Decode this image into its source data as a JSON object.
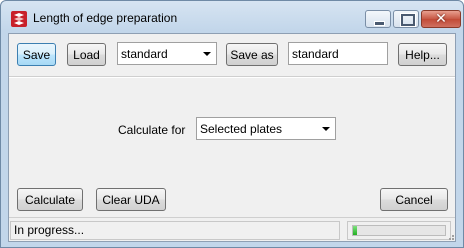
{
  "window": {
    "title": "Length of edge preparation",
    "close_glyph": "✕",
    "app_icon": "app-logo-icon",
    "minimize_icon": "minimize-icon",
    "maximize_icon": "maximize-icon"
  },
  "toolbar": {
    "save_label": "Save",
    "load_label": "Load",
    "settings_select_value": "standard",
    "save_as_label": "Save as",
    "save_as_name_value": "standard",
    "help_label": "Help..."
  },
  "main": {
    "calculate_for_label": "Calculate for",
    "calculate_for_value": "Selected plates"
  },
  "actions": {
    "calculate_label": "Calculate",
    "clear_uda_label": "Clear UDA",
    "cancel_label": "Cancel"
  },
  "status": {
    "text": "In progress...",
    "progress_fraction": 0.04,
    "progress_color": "#24b024"
  },
  "colors": {
    "titlebar": "#c2d6ea",
    "close_button": "#c75744",
    "focus_border": "#3c7fb1"
  }
}
